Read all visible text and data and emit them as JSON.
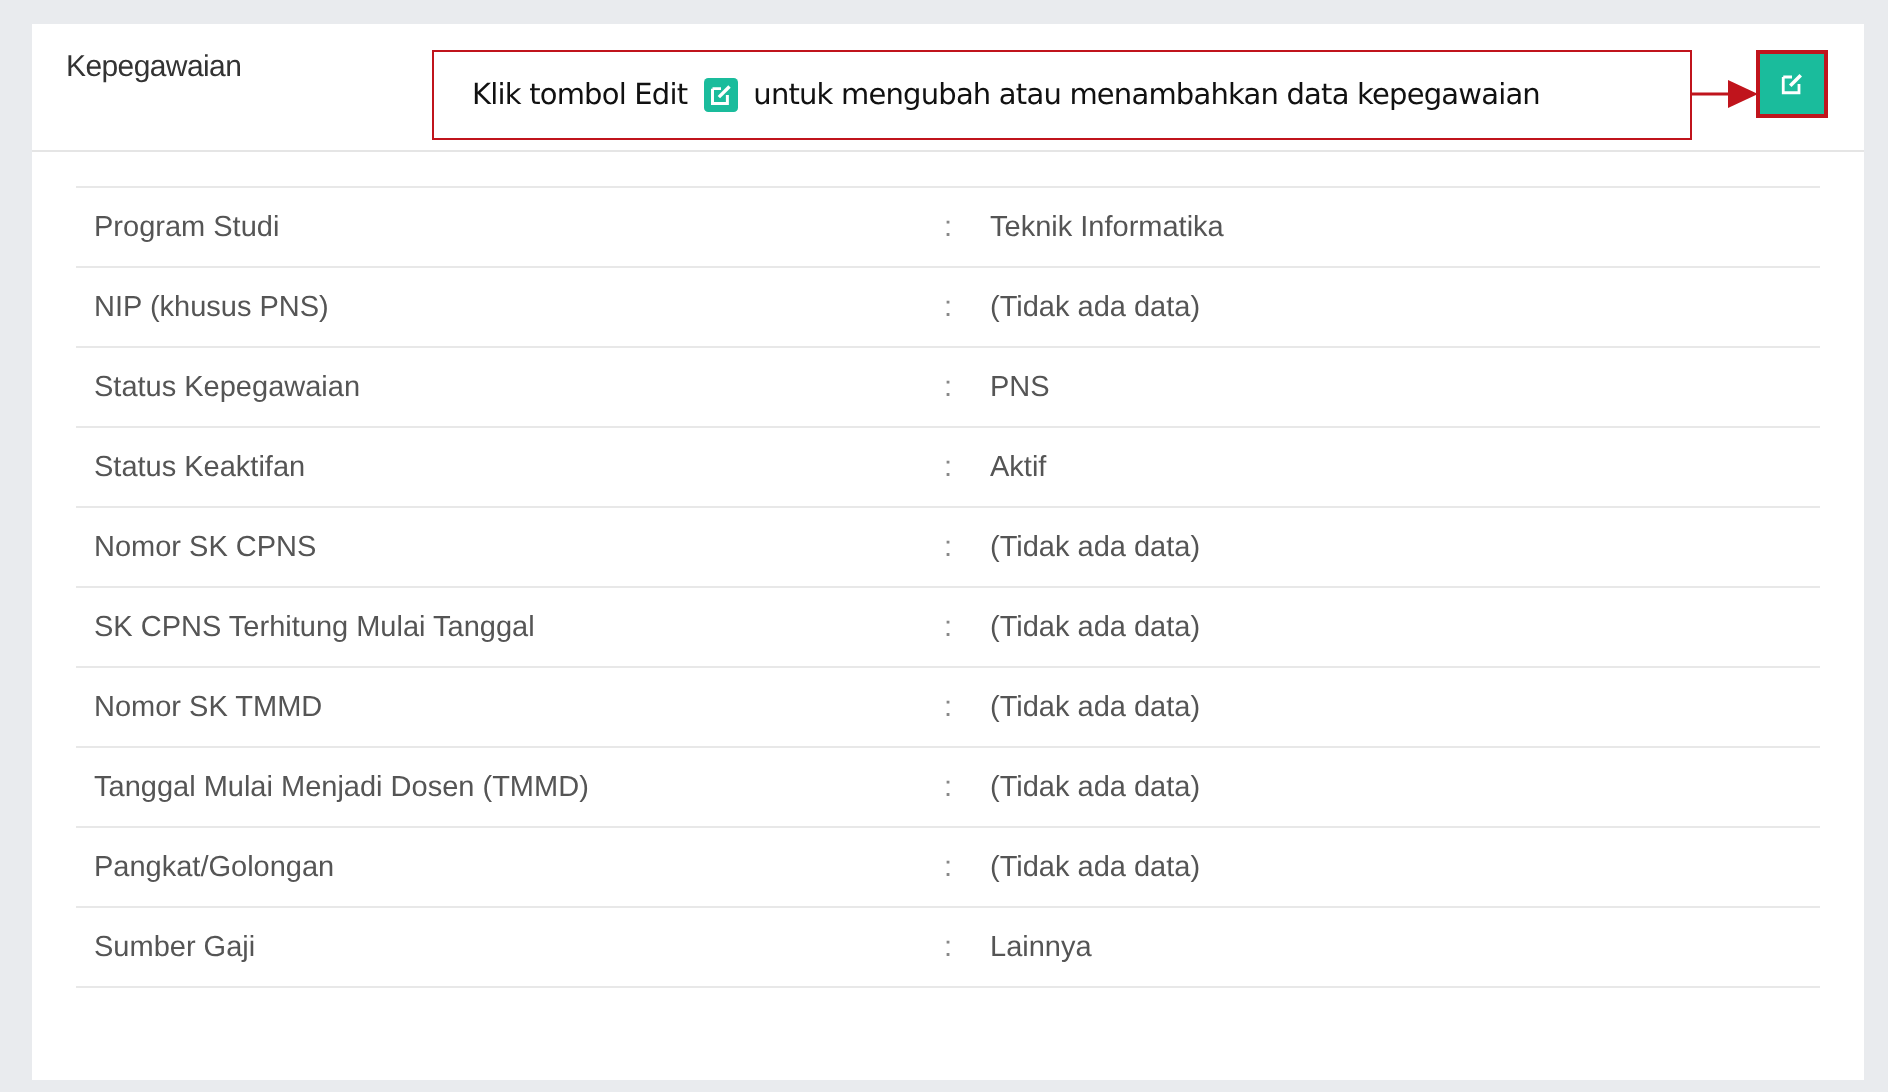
{
  "panel": {
    "title": "Kepegawaian"
  },
  "callout": {
    "text_before": "Klik tombol Edit",
    "text_after": "untuk mengubah atau menambahkan data kepegawaian"
  },
  "rows": [
    {
      "label": "Program Studi",
      "separator": ":",
      "value": "Teknik Informatika"
    },
    {
      "label": "NIP (khusus PNS)",
      "separator": ":",
      "value": "(Tidak ada data)"
    },
    {
      "label": "Status Kepegawaian",
      "separator": ":",
      "value": "PNS"
    },
    {
      "label": "Status Keaktifan",
      "separator": ":",
      "value": "Aktif"
    },
    {
      "label": "Nomor SK CPNS",
      "separator": ":",
      "value": "(Tidak ada data)"
    },
    {
      "label": "SK CPNS Terhitung Mulai Tanggal",
      "separator": ":",
      "value": "(Tidak ada data)"
    },
    {
      "label": "Nomor SK TMMD",
      "separator": ":",
      "value": "(Tidak ada data)"
    },
    {
      "label": "Tanggal Mulai Menjadi Dosen (TMMD)",
      "separator": ":",
      "value": "(Tidak ada data)"
    },
    {
      "label": "Pangkat/Golongan",
      "separator": ":",
      "value": "(Tidak ada data)"
    },
    {
      "label": "Sumber Gaji",
      "separator": ":",
      "value": "Lainnya"
    }
  ]
}
